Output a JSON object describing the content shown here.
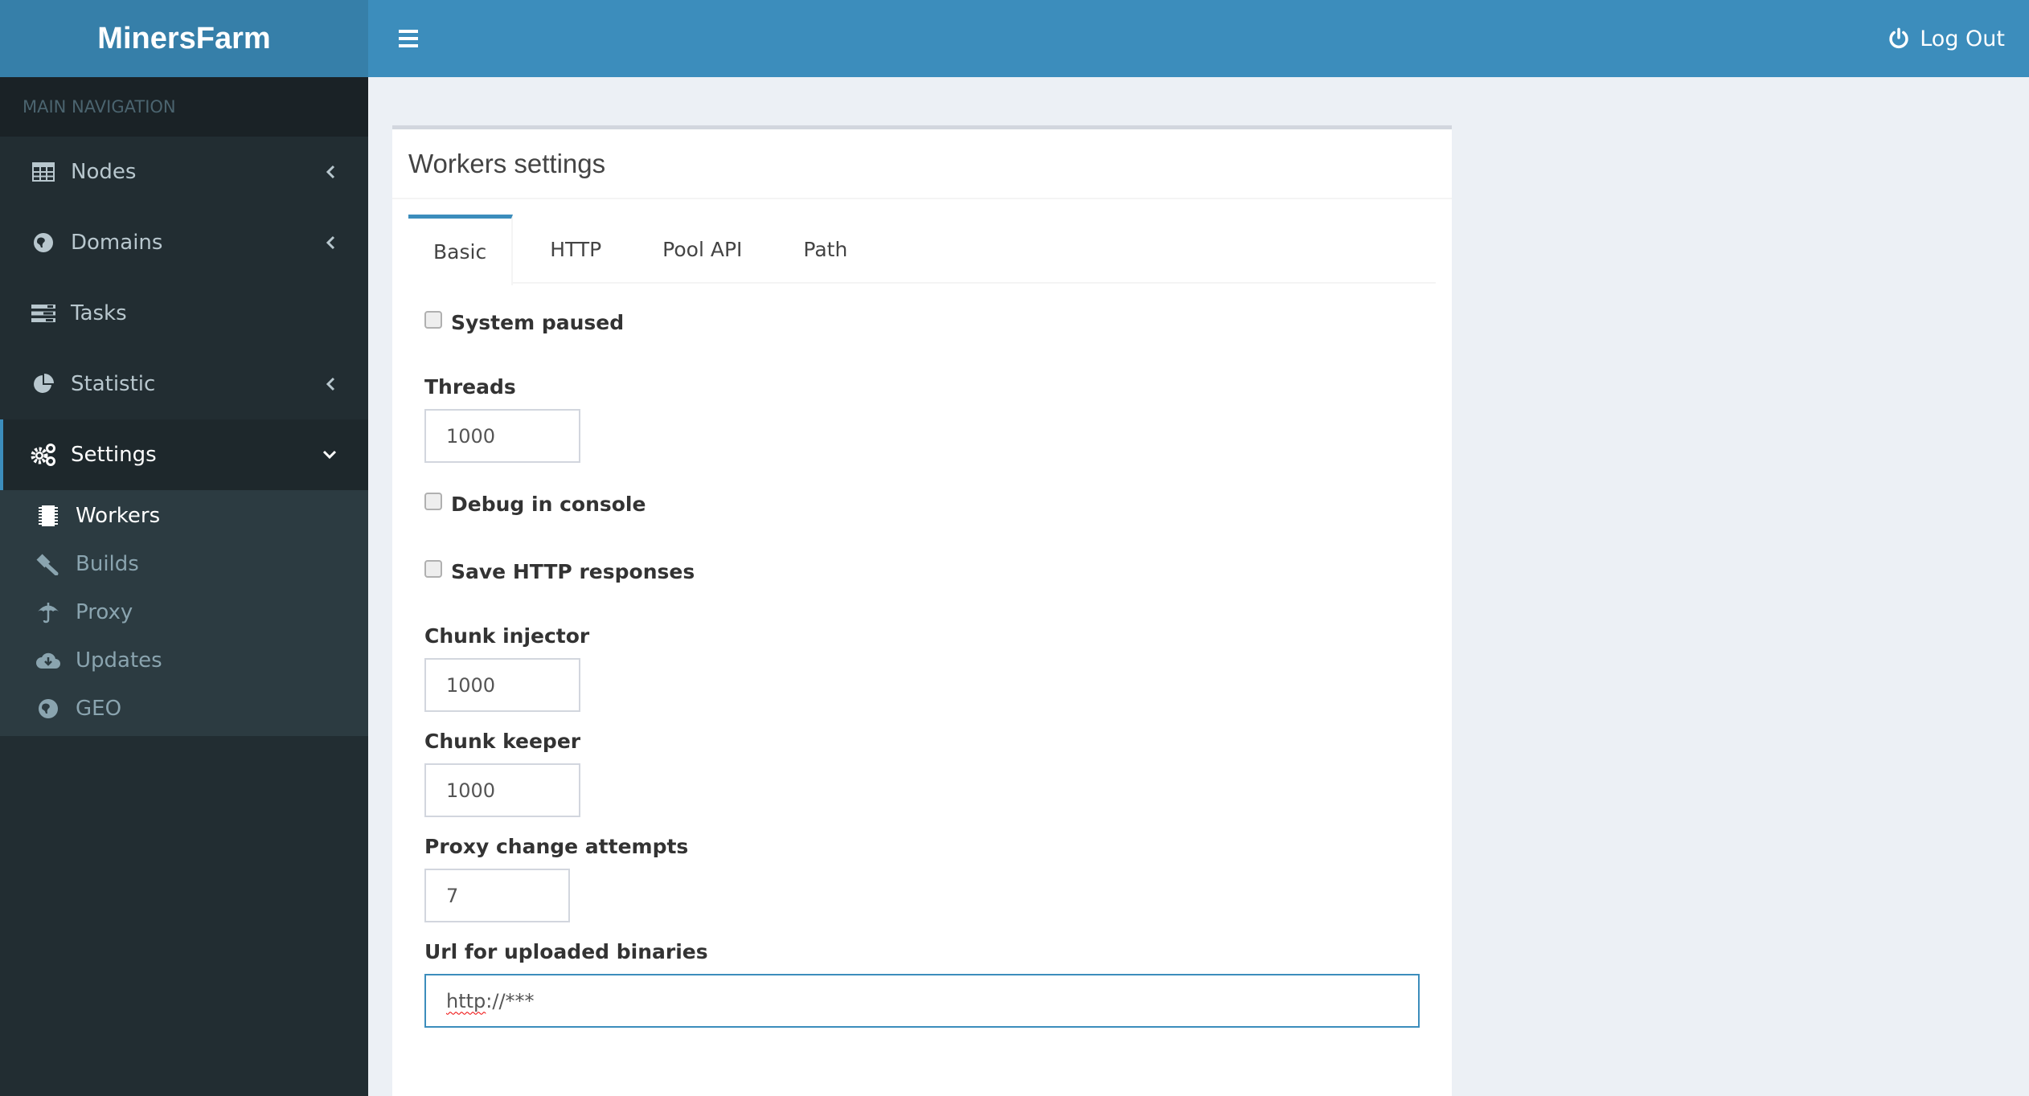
{
  "app": {
    "title": "MinersFarm"
  },
  "topbar": {
    "logout_label": "Log Out"
  },
  "sidebar": {
    "header": "MAIN NAVIGATION",
    "items": [
      {
        "label": "Nodes",
        "icon": "table-icon",
        "expanded": false
      },
      {
        "label": "Domains",
        "icon": "globe-icon",
        "expanded": false
      },
      {
        "label": "Tasks",
        "icon": "tasks-icon",
        "expanded": false
      },
      {
        "label": "Statistic",
        "icon": "pie-chart-icon",
        "expanded": false
      },
      {
        "label": "Settings",
        "icon": "gears-icon",
        "expanded": true,
        "active": true
      }
    ],
    "submenu": [
      {
        "label": "Workers",
        "icon": "microchip-icon",
        "active": true
      },
      {
        "label": "Builds",
        "icon": "gavel-icon"
      },
      {
        "label": "Proxy",
        "icon": "umbrella-icon"
      },
      {
        "label": "Updates",
        "icon": "cloud-download-icon"
      },
      {
        "label": "GEO",
        "icon": "globe-icon"
      }
    ]
  },
  "main": {
    "box_title": "Workers settings",
    "tabs": [
      {
        "label": "Basic",
        "active": true
      },
      {
        "label": "HTTP"
      },
      {
        "label": "Pool API"
      },
      {
        "label": "Path"
      }
    ],
    "form": {
      "system_paused": {
        "label": "System paused",
        "checked": false
      },
      "threads": {
        "label": "Threads",
        "value": "1000"
      },
      "debug_in_console": {
        "label": "Debug in console",
        "checked": false
      },
      "save_http_responses": {
        "label": "Save HTTP responses",
        "checked": false
      },
      "chunk_injector": {
        "label": "Chunk injector",
        "value": "1000"
      },
      "chunk_keeper": {
        "label": "Chunk keeper",
        "value": "1000"
      },
      "proxy_change_attempts": {
        "label": "Proxy change attempts",
        "value": "7"
      },
      "url_uploaded_binaries": {
        "label": "Url for uploaded binaries",
        "value_prefix": "http",
        "value_rest": "://***"
      }
    }
  },
  "colors": {
    "header": "#3c8dbc",
    "logo_bg": "#367fa9",
    "sidebar_bg": "#222d32",
    "sidebar_header_bg": "#1a2226",
    "submenu_bg": "#2c3b41",
    "content_bg": "#ecf0f5",
    "accent": "#3c8dbc"
  }
}
